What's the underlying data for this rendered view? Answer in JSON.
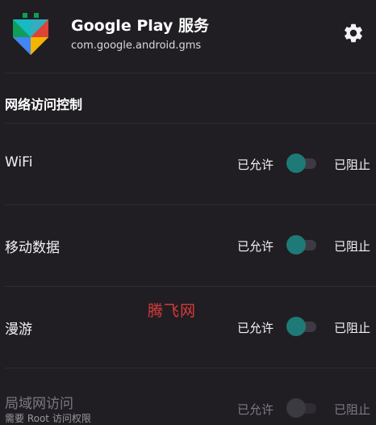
{
  "header": {
    "app_name": "Google Play 服务",
    "package_name": "com.google.android.gms",
    "settings_icon": "gear-icon",
    "app_icon": "google-play-services-icon"
  },
  "section": {
    "title": "网络访问控制"
  },
  "rows": [
    {
      "label": "WiFi",
      "sub": "",
      "allow_label": "已允许",
      "block_label": "已阻止",
      "state": "allowed",
      "enabled": true
    },
    {
      "label": "移动数据",
      "sub": "",
      "allow_label": "已允许",
      "block_label": "已阻止",
      "state": "allowed",
      "enabled": true
    },
    {
      "label": "漫游",
      "sub": "",
      "allow_label": "已允许",
      "block_label": "已阻止",
      "state": "allowed",
      "enabled": true
    },
    {
      "label": "局域网访问",
      "sub": "需要 Root 访问权限",
      "allow_label": "已允许",
      "block_label": "已阻止",
      "state": "allowed",
      "enabled": false
    }
  ],
  "watermark": "腾飞网",
  "colors": {
    "background": "#201e23",
    "accent": "#1e7a76",
    "track": "#3d3a43"
  }
}
